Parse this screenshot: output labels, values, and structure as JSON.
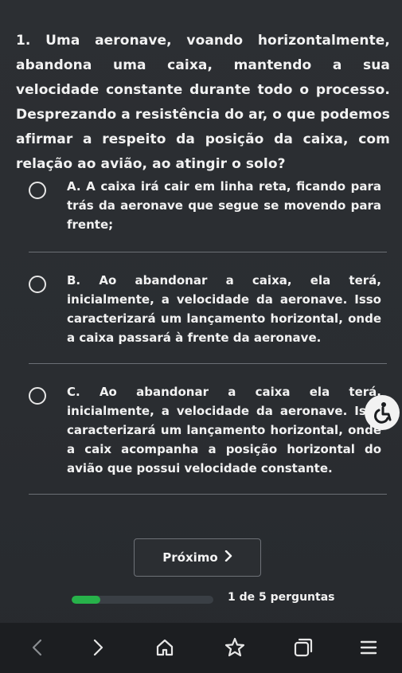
{
  "question": {
    "text": "1. Uma aeronave, voando horizontalmente, abandona uma caixa, mantendo a sua velocidade constante durante todo o processo. Desprezando a resistência do ar, o que podemos afirmar a respeito da posição da caixa, com relação ao avião, ao atingir o solo?"
  },
  "options": [
    {
      "text": "A. A caixa irá cair em linha reta, ficando para trás da aeronave que segue se movendo para frente;"
    },
    {
      "text": "B. Ao abandonar a caixa, ela terá, inicialmente, a velocidade da aeronave. Isso caracterizará um lançamento horizontal, onde a caixa passará à frente da aeronave."
    },
    {
      "text": "C. Ao abandonar a caixa ela terá, inicialmente, a velocidade da aeronave. Isso caracterizará um lançamento horizontal, onde a caix acompanha a posição horizontal do avião que possui velocidade constante."
    }
  ],
  "footer": {
    "next_label": "Próximo",
    "progress_text": "1 de 5 perguntas",
    "progress_fraction": 0.2,
    "progress_color": "#27b24a"
  },
  "icons": {
    "floating": "accessibility-icon",
    "nav": [
      "back-icon",
      "forward-icon",
      "home-icon",
      "star-icon",
      "tabs-icon",
      "menu-icon"
    ]
  }
}
